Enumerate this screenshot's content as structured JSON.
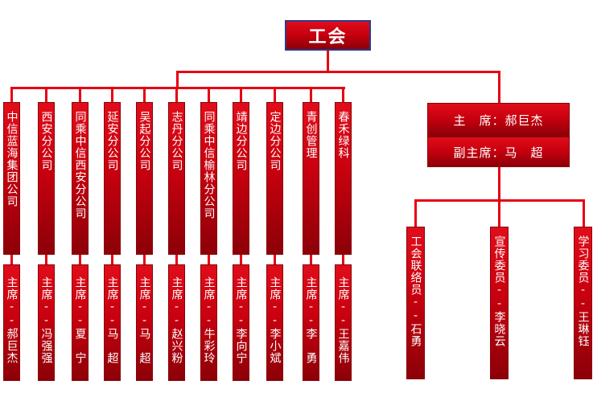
{
  "root": {
    "title": "工会"
  },
  "leadership": {
    "chair": "主　席：郝巨杰",
    "vice_chair": "副主席：马　超"
  },
  "branches": [
    {
      "name": "中信蓝海集团公司",
      "leader": "主席--郝巨杰"
    },
    {
      "name": "西安分公司",
      "leader": "主席--冯强强"
    },
    {
      "name": "同乘中信西安分公司",
      "leader": "主席--夏　宁"
    },
    {
      "name": "延安分公司",
      "leader": "主席--马　超"
    },
    {
      "name": "吴起分公司",
      "leader": "主席--马　超"
    },
    {
      "name": "志丹分公司",
      "leader": "主席--赵兴粉"
    },
    {
      "name": "同乘中信榆林分公司",
      "leader": "主席--牛彩玲"
    },
    {
      "name": "靖边分公司",
      "leader": "主席--李向宁"
    },
    {
      "name": "定边分公司",
      "leader": "主席--李小斌"
    },
    {
      "name": "青创管理",
      "leader": "主席--李　勇"
    },
    {
      "name": "春禾绿科",
      "leader": "主席--王嘉伟"
    }
  ],
  "committee": [
    {
      "role": "工会联络员--石勇"
    },
    {
      "role": "宣传委员--李晓云"
    },
    {
      "role": "学习委员--王琳钰"
    }
  ],
  "colors": {
    "box": "#c8000f",
    "line": "#e60012",
    "title_border": "#2a3b8f"
  }
}
